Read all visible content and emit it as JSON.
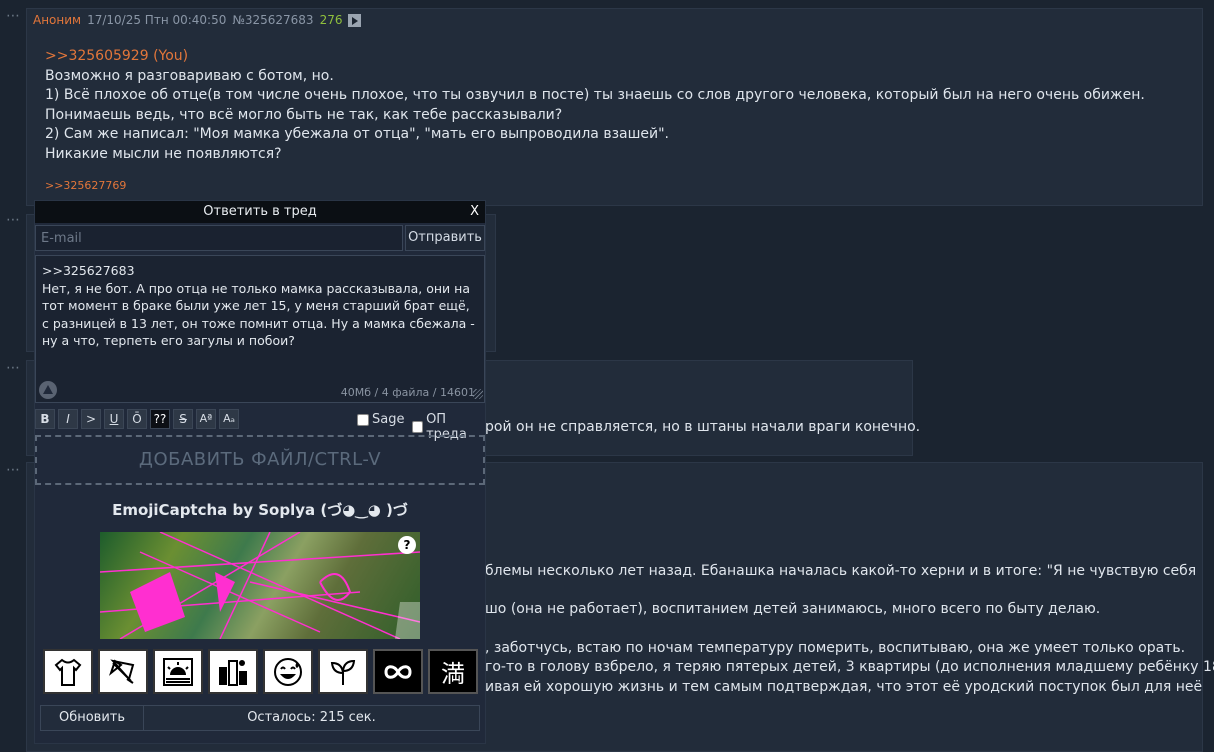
{
  "post1": {
    "poster": "Аноним",
    "datetime": "17/10/25 Птн 00:40:50",
    "post_no": "№325627683",
    "count": "276",
    "quote": ">>325605929 (You)",
    "lines": [
      "Возможно я разговариваю с ботом, но.",
      "1) Всё плохое об отце(в том числе очень плохое, что ты озвучил в посте) ты знаешь со слов другого человека, который был на него очень обижен. Понимаешь ведь, что всё могло быть не так, как тебе рассказывали?",
      "2) Сам же написал: \"Моя мамка убежала от отца\", \"мать его выпроводила взашей\".",
      "Никакие мысли не появляются?"
    ],
    "reply": ">>325627769"
  },
  "bg_post2": {
    "text": "рой он не справляется, но в штаны начали враги конечно."
  },
  "bg_post3": {
    "lines": [
      "блемы несколько лет назад. Ебанашка началась какой-то херни и в итоге: \"Я не чувствую себя",
      "шо (она не работает), воспитанием детей занимаюсь, много всего по быту делаю.",
      ", заботчусь, встаю по ночам температуру померить, воспитываю, она же умеет только орать.",
      "го-то в голову взбрело, я теряю пятерых детей, 3 квартиры (до исполнения младшему ребёнку 18",
      "ивая ей хорошую жизнь и тем самым подтверждая, что этот её уродский поступок был для неё"
    ]
  },
  "form": {
    "title": "Ответить в тред",
    "close": "X",
    "email_placeholder": "E-mail",
    "send": "Отправить",
    "message": ">>325627683\nНет, я не бот. А про отца не только мамка рассказывала, они на тот момент в браке были уже лет 15, у меня старший брат ещё, с разницей в 13 лет, он тоже помнит отца. Ну а мамка сбежала - ну а что, терпеть его загулы и побои?",
    "status": "40Мб / 4 файла / 14601",
    "toolbar": [
      "B",
      "I",
      ">",
      "U",
      "Ō",
      "??",
      "S",
      "Aª",
      "Aₐ"
    ],
    "sage": "Sage",
    "op": "ОП треда",
    "dropzone": "ДОБАВИТЬ ФАЙЛ/CTRL-V",
    "captcha_title": "EmojiCaptcha by Soplya (づ◕‿◕ )づ",
    "captcha_help": "?",
    "emoji": [
      "shirt-icon",
      "umbrella-icon",
      "sunrise-icon",
      "city-icon",
      "grinning-sweat-icon",
      "seedling-icon",
      "infinity-icon",
      "full-kanji-icon"
    ],
    "kanji": "満",
    "refresh": "Обновить",
    "timer": "Осталось: 215 сек."
  }
}
